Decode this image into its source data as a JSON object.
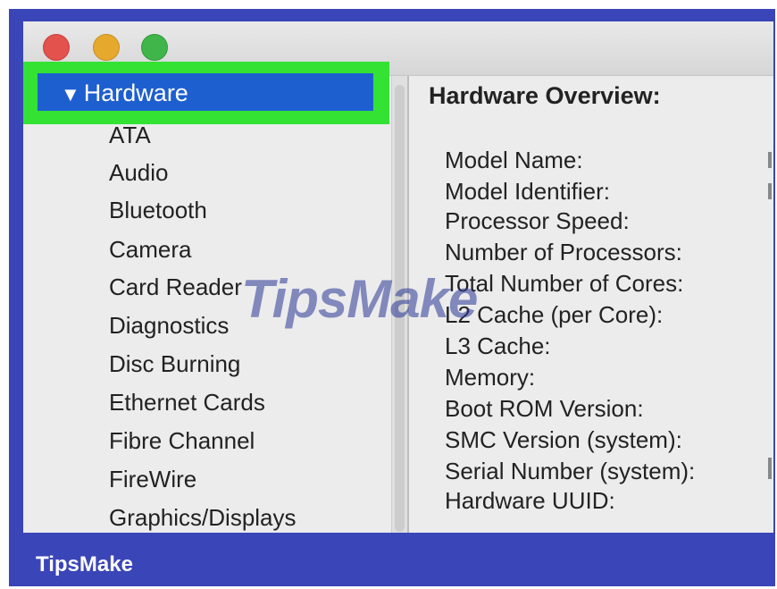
{
  "sidebar": {
    "selected": "Hardware",
    "items": [
      "ATA",
      "Audio",
      "Bluetooth",
      "Camera",
      "Card Reader",
      "Diagnostics",
      "Disc Burning",
      "Ethernet Cards",
      "Fibre Channel",
      "FireWire",
      "Graphics/Displays"
    ]
  },
  "content": {
    "title": "Hardware Overview:",
    "specs": [
      "Model Name:",
      "Model Identifier:",
      "Processor Speed:",
      "Number of Processors:",
      "Total Number of Cores:",
      "L2 Cache (per Core):",
      "L3 Cache:",
      "Memory:",
      "Boot ROM Version:",
      "SMC Version (system):",
      "Serial Number (system):",
      "Hardware UUID:"
    ]
  },
  "watermark": "TipsMake",
  "brand": "TipsMake",
  "colors": {
    "frame_blue": "#3a45b8",
    "highlight_green": "#34e234",
    "selection_blue": "#1e5fd0"
  }
}
